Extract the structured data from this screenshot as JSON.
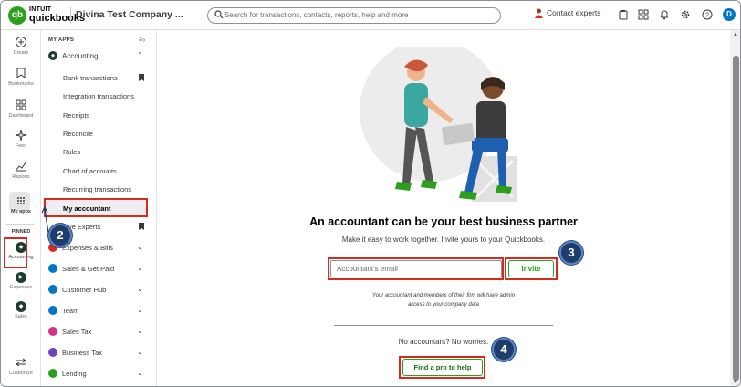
{
  "header": {
    "logo_brand": "INTUIT",
    "logo_product": "quickbooks",
    "company_name": "Divina Test Company ...",
    "search_placeholder": "Search for transactions, contacts, reports, help and more",
    "contact_experts": "Contact experts",
    "avatar_initial": "D"
  },
  "rail": {
    "create": "Create",
    "bookmarks": "Bookmarks",
    "dashboard": "Dashboard",
    "feed": "Feed",
    "reports": "Reports",
    "my_apps": "My apps",
    "pinned": "PINNED",
    "accounting": "Accounting",
    "expenses": "Expenses",
    "sales": "Sales",
    "customize": "Customize"
  },
  "panel": {
    "heading": "MY APPS",
    "accounting_label": "Accounting",
    "sub_items": [
      "Bank transactions",
      "Integration transactions",
      "Receipts",
      "Reconcile",
      "Rules",
      "Chart of accounts",
      "Recurring transactions",
      "My accountant",
      "Live Experts"
    ],
    "apps": [
      {
        "label": "Expenses & Bills",
        "color": "#d52b1e"
      },
      {
        "label": "Sales & Get Paid",
        "color": "#0077c5"
      },
      {
        "label": "Customer Hub",
        "color": "#0077c5"
      },
      {
        "label": "Team",
        "color": "#0077c5"
      },
      {
        "label": "Sales Tax",
        "color": "#d63384"
      },
      {
        "label": "Business Tax",
        "color": "#6f42c1"
      },
      {
        "label": "Lending",
        "color": "#2ca01c"
      }
    ]
  },
  "callouts": {
    "c2": "2",
    "c3": "3",
    "c4": "4"
  },
  "main": {
    "headline": "An accountant can be your best business partner",
    "subline": "Make it easy to work together. Invite yours to your Quickbooks.",
    "email_placeholder": "Accountant's email",
    "invite_label": "Invite",
    "note_line1": "Your accountant and members of their firm will have admin",
    "note_line2": "access to your company data",
    "no_accountant": "No accountant? No worries.",
    "find_pro_label": "Find a pro to help"
  },
  "colors": {
    "brand_green": "#2ca01c",
    "highlight_red": "#d52b1e",
    "callout_navy": "#1e3d6b"
  }
}
